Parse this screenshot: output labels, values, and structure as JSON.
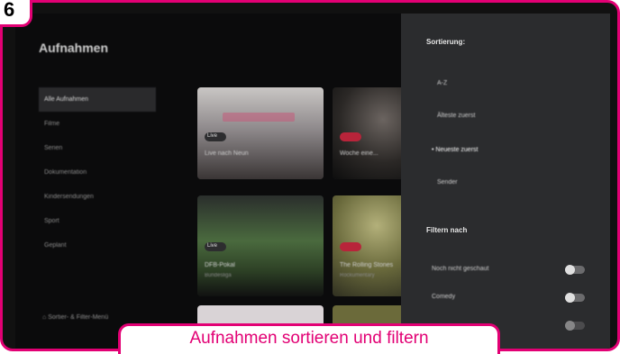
{
  "step_number": "6",
  "caption": "Aufnahmen sortieren und filtern",
  "colors": {
    "brand": "#e20074",
    "panel": "#2b2c2e",
    "background": "#0b0b0c"
  },
  "screen": {
    "title": "Aufnahmen",
    "nav": [
      {
        "label": "Alle Aufnahmen",
        "active": true
      },
      {
        "label": "Filme"
      },
      {
        "label": "Serien"
      },
      {
        "label": "Dokumentation"
      },
      {
        "label": "Kindersendungen"
      },
      {
        "label": "Sport"
      },
      {
        "label": "Geplant"
      }
    ],
    "footer_hint": "Sortier- & Filter-Menü",
    "cards": [
      {
        "title": "Live nach Neun",
        "badge": "Live"
      },
      {
        "title": "Woche eine...",
        "badge": ""
      },
      {
        "title": "DFB-Pokal",
        "sub": "Bundesliga",
        "badge": "Live"
      },
      {
        "title": "The Rolling Stones",
        "sub": "Rockumentary",
        "badge": ""
      }
    ]
  },
  "panel": {
    "sort_heading": "Sortierung:",
    "sort_options": [
      {
        "label": "A-Z"
      },
      {
        "label": "Älteste zuerst"
      },
      {
        "label": "• Neueste zuerst",
        "selected": true
      },
      {
        "label": "Sender"
      }
    ],
    "filter_heading": "Filtern nach",
    "filters": [
      {
        "label": "Noch nicht geschaut",
        "on": false
      },
      {
        "label": "Comedy",
        "on": false
      },
      {
        "label": "",
        "on": false
      }
    ]
  }
}
